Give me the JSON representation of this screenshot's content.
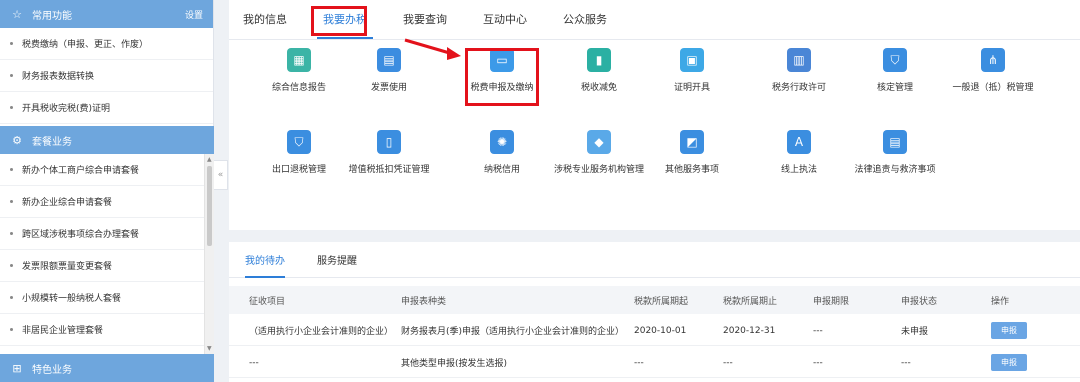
{
  "sidebar": {
    "common": {
      "title": "常用功能",
      "settings": "设置",
      "items": [
        "税费缴纳（申报、更正、作废）",
        "财务报表数据转换",
        "开具税收完税(费)证明"
      ]
    },
    "packages": {
      "title": "套餐业务",
      "items": [
        "新办个体工商户综合申请套餐",
        "新办企业综合申请套餐",
        "跨区域涉税事项综合办理套餐",
        "发票限额票量变更套餐",
        "小规模转一般纳税人套餐",
        "非居民企业管理套餐"
      ]
    },
    "special": {
      "title": "特色业务"
    }
  },
  "tabs": [
    "我的信息",
    "我要办税",
    "我要查询",
    "互动中心",
    "公众服务"
  ],
  "grid": {
    "row1": [
      {
        "label": "综合信息报告",
        "icon": "report-icon",
        "color": "#3bb4a6"
      },
      {
        "label": "发票使用",
        "icon": "invoice-icon",
        "color": "#3c8de0"
      },
      {
        "label": "税费申报及缴纳",
        "icon": "monitor-icon",
        "color": "#3c9ae8"
      },
      {
        "label": "税收减免",
        "icon": "bar-chart-icon",
        "color": "#2bb0a3"
      },
      {
        "label": "证明开具",
        "icon": "certificate-icon",
        "color": "#3da8e6"
      },
      {
        "label": "税务行政许可",
        "icon": "license-icon",
        "color": "#4a86d6"
      },
      {
        "label": "核定管理",
        "icon": "shield-check-icon",
        "color": "#3b8ee0"
      },
      {
        "label": "一般退（抵）税管理",
        "icon": "hierarchy-icon",
        "color": "#3b8ee0"
      }
    ],
    "row2": [
      {
        "label": "出口退税管理",
        "icon": "shield-icon",
        "color": "#3b8ee0"
      },
      {
        "label": "增值税抵扣凭证管理",
        "icon": "lock-icon",
        "color": "#3b8ee0"
      },
      {
        "label": "纳税信用",
        "icon": "medal-icon",
        "color": "#3b8ee0"
      },
      {
        "label": "涉税专业服务机构管理",
        "icon": "tag-icon",
        "color": "#5aa9e8"
      },
      {
        "label": "其他服务事项",
        "icon": "monitor-chart-icon",
        "color": "#3b8ee0"
      },
      {
        "label": "线上执法",
        "icon": "translate-icon",
        "color": "#3b8ee0"
      },
      {
        "label": "法律追责与救济事项",
        "icon": "document-icon",
        "color": "#3b8ee0"
      }
    ]
  },
  "bottom": {
    "tabs": [
      "我的待办",
      "服务提醒"
    ],
    "columns": [
      "征收项目",
      "申报表种类",
      "税款所属期起",
      "税款所属期止",
      "申报期限",
      "申报状态",
      "操作"
    ],
    "rows": [
      [
        "（适用执行小企业会计准则的企业）",
        "财务报表月(季)申报（适用执行小企业会计准则的企业）",
        "2020-10-01",
        "2020-12-31",
        "---",
        "未申报",
        "申报"
      ],
      [
        "---",
        "其他类型申报(按发生选报)",
        "---",
        "---",
        "---",
        "---",
        "申报"
      ]
    ]
  },
  "colors": {
    "accent": "#2d7ed8",
    "sidebar_header": "#6ea6dd",
    "highlight": "#e3121b"
  }
}
